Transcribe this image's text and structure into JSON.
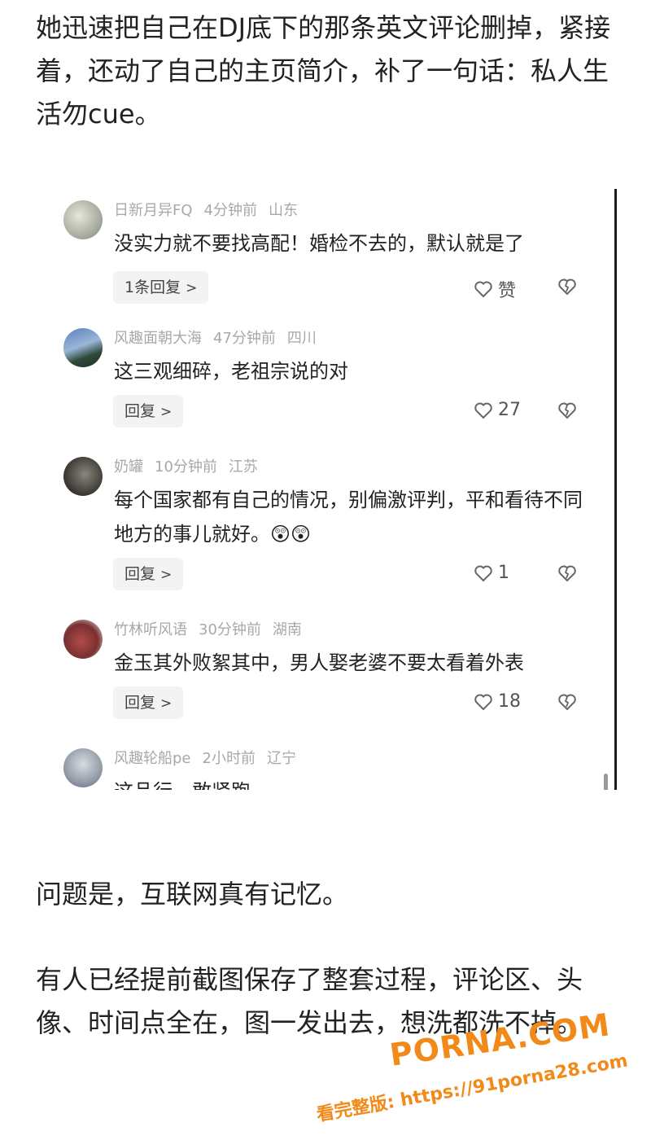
{
  "article": {
    "para1": "她迅速把自己在DJ底下的那条英文评论删掉，紧接着，还动了自己的主页简介，补了一句话：私人生活勿cue。",
    "para2": "问题是，互联网真有记忆。",
    "para3": "有人已经提前截图保存了整套过程，评论区、头像、时间点全在，图一发出去，想洗都洗不掉。"
  },
  "comments": [
    {
      "username": "日新月异FQ",
      "time": "4分钟前",
      "location": "山东",
      "text": "没实力就不要找高配！婚检不去的，默认就是了",
      "reply_label": "1条回复",
      "likes": "赞"
    },
    {
      "username": "风趣面朝大海",
      "time": "47分钟前",
      "location": "四川",
      "text": "这三观细碎，老祖宗说的对",
      "reply_label": "回复",
      "likes": "27"
    },
    {
      "username": "奶罐",
      "time": "10分钟前",
      "location": "江苏",
      "text": "每个国家都有自己的情况，别偏激评判，平和看待不同地方的事儿就好。😲😲",
      "reply_label": "回复",
      "likes": "1"
    },
    {
      "username": "竹林听风语",
      "time": "30分钟前",
      "location": "湖南",
      "text": "金玉其外败絮其中，男人娶老婆不要太看着外表",
      "reply_label": "回复",
      "likes": "18"
    },
    {
      "username": "风趣轮船pe",
      "time": "2小时前",
      "location": "辽宁",
      "text": "这品行，敢紧跑",
      "reply_label": "",
      "likes": ""
    }
  ],
  "icons": {
    "like": "heart-outline-icon",
    "dislike": "broken-heart-icon",
    "chevron": "chevron-right-icon"
  },
  "watermark": {
    "brand": "PORNA.COM",
    "url": "看完整版: https://91porna28.com"
  },
  "colors": {
    "meta_text": "#a8a8a8",
    "reply_bg": "#f3f3f3",
    "watermark": "#f28a1a"
  }
}
